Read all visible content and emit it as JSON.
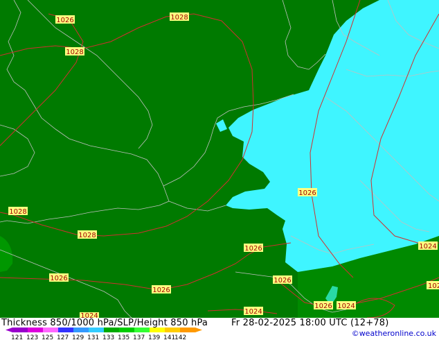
{
  "title": "Thickness 850/1000 hPa/SLP/Height 850 hPa",
  "valid_time": "Fr 28-02-2025 18:00 UTC (12+78)",
  "credit": "©weatheronline.co.uk",
  "colors": {
    "land_dark_green": "#007a00",
    "cyan_field": "#3ff5ff",
    "isobar": "#d03030",
    "coastline": "#c0c0c0",
    "label_box": "#ffff80"
  },
  "isobar_labels": [
    {
      "text": "1026"
    },
    {
      "text": "1028"
    },
    {
      "text": "1028"
    },
    {
      "text": "1028"
    },
    {
      "text": "1028"
    },
    {
      "text": "1026"
    },
    {
      "text": "1026"
    },
    {
      "text": "1026"
    },
    {
      "text": "1026"
    },
    {
      "text": "1026"
    },
    {
      "text": "1024"
    },
    {
      "text": "1024"
    },
    {
      "text": "1026"
    },
    {
      "text": "1024"
    },
    {
      "text": "1024"
    },
    {
      "text": "102"
    }
  ],
  "legend": {
    "ticks": [
      "121",
      "123",
      "125",
      "127",
      "129",
      "131",
      "133",
      "135",
      "137",
      "139",
      "141",
      "142"
    ],
    "colors": [
      "#9900cc",
      "#dd00dd",
      "#ff66ff",
      "#3333ff",
      "#3399ff",
      "#33ccff",
      "#00aa00",
      "#00cc00",
      "#33ff33",
      "#ffff00",
      "#ffcc00",
      "#ff9900",
      "#ff9900"
    ]
  }
}
